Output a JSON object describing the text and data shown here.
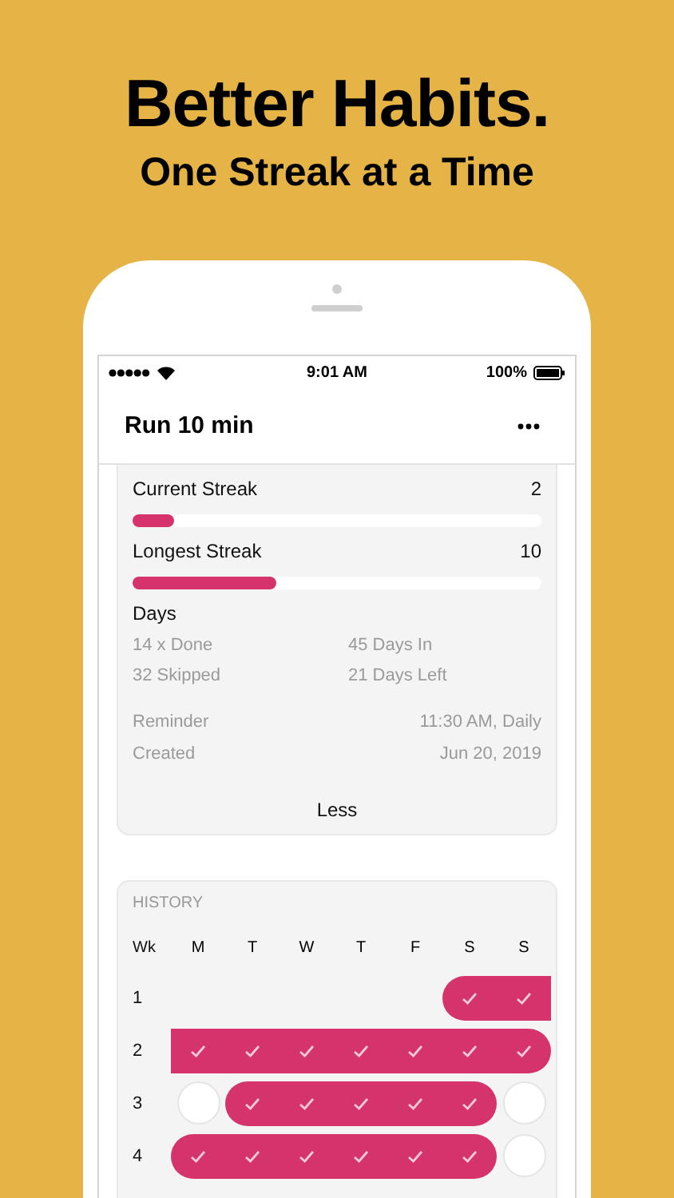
{
  "headline": "Better Habits.",
  "subheadline": "One Streak at a Time",
  "status_bar": {
    "time": "9:01 AM",
    "battery": "100%"
  },
  "nav": {
    "title": "Run 10 min"
  },
  "streaks": [
    {
      "label": "Current Streak",
      "value": "2",
      "level": 0.1
    },
    {
      "label": "Longest Streak",
      "value": "10",
      "level": 0.35
    }
  ],
  "days": {
    "title": "Days",
    "stats": [
      "14 x Done",
      "45 Days In",
      "32 Skipped",
      "21 Days Left"
    ]
  },
  "details": [
    {
      "label": "Reminder",
      "value": "11:30 AM, Daily"
    },
    {
      "label": "Created",
      "value": "Jun 20, 2019"
    }
  ],
  "toggle": "Less",
  "history": {
    "title": "HISTORY",
    "week_heading": "Wk",
    "weekdays": [
      "M",
      "T",
      "W",
      "T",
      "F",
      "S",
      "S"
    ],
    "weeks": [
      {
        "number": "1",
        "days": [
          {
            "kind": "blank"
          },
          {
            "kind": "blank"
          },
          {
            "kind": "blank"
          },
          {
            "kind": "blank"
          },
          {
            "kind": "blank"
          },
          {
            "kind": "done"
          },
          {
            "kind": "done"
          }
        ]
      },
      {
        "number": "2",
        "days": [
          {
            "kind": "done"
          },
          {
            "kind": "done"
          },
          {
            "kind": "done"
          },
          {
            "kind": "done"
          },
          {
            "kind": "done"
          },
          {
            "kind": "done"
          },
          {
            "kind": "done"
          }
        ]
      },
      {
        "number": "3",
        "days": [
          {
            "kind": "missed"
          },
          {
            "kind": "done"
          },
          {
            "kind": "done"
          },
          {
            "kind": "done"
          },
          {
            "kind": "done"
          },
          {
            "kind": "done"
          },
          {
            "kind": "missed"
          }
        ]
      },
      {
        "number": "4",
        "days": [
          {
            "kind": "done"
          },
          {
            "kind": "done"
          },
          {
            "kind": "done"
          },
          {
            "kind": "done"
          },
          {
            "kind": "done"
          },
          {
            "kind": "done"
          },
          {
            "kind": "missed"
          }
        ]
      }
    ]
  }
}
